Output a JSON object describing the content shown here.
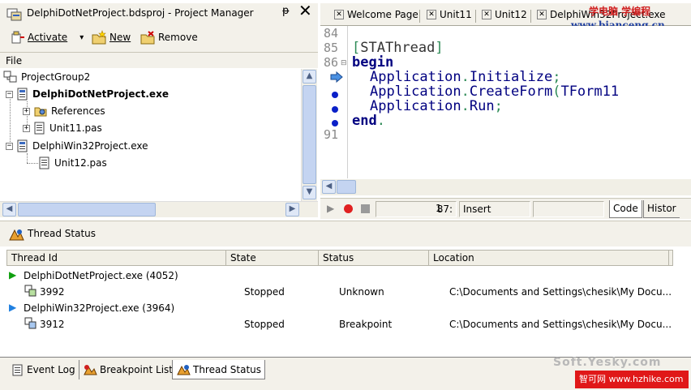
{
  "project_manager": {
    "title": "DelphiDotNetProject.bdsproj - Project Manager",
    "pin_glyph": "ᵽ",
    "close_glyph": "✕",
    "toolbar": {
      "activate": "Activate",
      "new": "New",
      "remove": "Remove",
      "dropdown_glyph": "▾"
    },
    "file_label": "File",
    "tree": {
      "group": "ProjectGroup2",
      "project1": "DelphiDotNetProject.exe",
      "references": "References",
      "unit11": "Unit11.pas",
      "project2": "DelphiWin32Project.exe",
      "unit12": "Unit12.pas"
    }
  },
  "editor": {
    "tabs": [
      "Welcome Page",
      "Unit11",
      "Unit12",
      "DelphiWin32Project.exe"
    ],
    "line_numbers": [
      "84",
      "85",
      "86",
      "",
      "",
      "",
      "",
      "91"
    ],
    "code": {
      "l85_open": "[",
      "l85_text": "STAThread",
      "l85_close": "]",
      "l86": "begin",
      "l87_a": "Application",
      "l87_b": ".",
      "l87_c": "Initialize",
      "l87_d": ";",
      "l88_a": "Application",
      "l88_b": ".",
      "l88_c": "CreateForm",
      "l88_d": "(",
      "l88_e": "TForm11",
      "l89_a": "Application",
      "l89_b": ".",
      "l89_c": "Run",
      "l89_d": ";",
      "l90": "end",
      "l90_dot": "."
    },
    "status": {
      "position": "87:",
      "column": "1",
      "mode": "Insert",
      "code_tab": "Code",
      "history_tab": "Histor"
    }
  },
  "thread_status": {
    "title": "Thread Status",
    "columns": [
      "Thread Id",
      "State",
      "Status",
      "Location"
    ],
    "rows": [
      {
        "thread": "DelphiDotNetProject.exe (4052)",
        "state": "",
        "status": "",
        "location": ""
      },
      {
        "thread": "3992",
        "state": "Stopped",
        "status": "Unknown",
        "location": "C:\\Documents and Settings\\chesik\\My Docu..."
      },
      {
        "thread": "DelphiWin32Project.exe (3964)",
        "state": "",
        "status": "",
        "location": ""
      },
      {
        "thread": "3912",
        "state": "Stopped",
        "status": "Breakpoint",
        "location": "C:\\Documents and Settings\\chesik\\My Docu..."
      }
    ]
  },
  "bottom_tabs": [
    "Event Log",
    "Breakpoint List",
    "Thread Status"
  ],
  "watermarks": {
    "top": "学电脑 学编程",
    "top_url": "www.bianceng.cn",
    "bottom": "Soft.Yesky.com",
    "bottom_site": "智可网 www.hzhike.com"
  },
  "colors": {
    "keyword": "#000080",
    "execution_line": "#d79a9a",
    "breakpoint": "#0a20c8",
    "panel_bg": "#f3f1ea"
  }
}
